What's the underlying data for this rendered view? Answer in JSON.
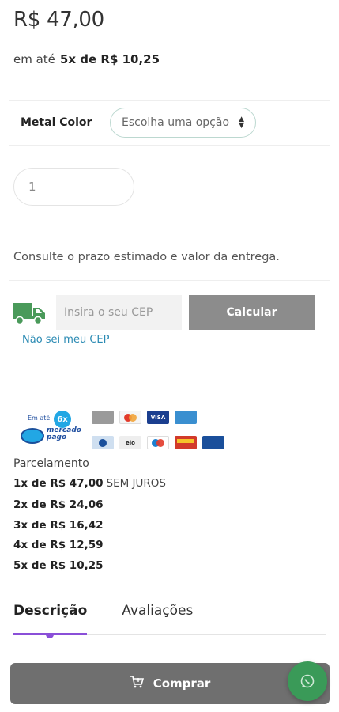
{
  "product": {
    "price": "R$ 47,00",
    "installment_prefix": "em até",
    "installment_value": "5x de R$ 10,25"
  },
  "variant": {
    "label": "Metal Color",
    "select_placeholder": "Escolha uma opção"
  },
  "quantity": {
    "value": "1"
  },
  "shipping": {
    "info": "Consulte o prazo estimado e valor da entrega.",
    "cep_placeholder": "Insira o seu CEP",
    "calculate_label": "Calcular",
    "no_cep_link": "Não sei meu CEP"
  },
  "payment": {
    "mp_upto": "Em até",
    "mp_badge": "6x",
    "mp_brand_line1": "mercado",
    "mp_brand_line2": "pago",
    "cards_row1": [
      {
        "name": "boleto",
        "color": "#9a9a9a"
      },
      {
        "name": "mastercard",
        "color": "#e8a13a"
      },
      {
        "name": "visa",
        "color": "#1a3e8f"
      },
      {
        "name": "amex",
        "color": "#3a8fd0"
      }
    ],
    "cards_row2": [
      {
        "name": "diners",
        "color": "#cfdff0"
      },
      {
        "name": "elo",
        "color": "#eeeeee"
      },
      {
        "name": "maestro",
        "color": "#e15b5b"
      },
      {
        "name": "hipercard",
        "color": "#d23a2a"
      },
      {
        "name": "visa-electron",
        "color": "#1a4f9b"
      }
    ]
  },
  "installments": {
    "title": "Parcelamento",
    "lines": [
      {
        "label": "1x de R$ 47,00",
        "note": "SEM JUROS"
      },
      {
        "label": "2x de R$ 24,06",
        "note": ""
      },
      {
        "label": "3x de R$ 16,42",
        "note": ""
      },
      {
        "label": "4x de R$ 12,59",
        "note": ""
      },
      {
        "label": "5x de R$ 10,25",
        "note": ""
      }
    ]
  },
  "tabs": {
    "description": "Descrição",
    "reviews": "Avaliações"
  },
  "buy": {
    "label": "Comprar"
  },
  "colors": {
    "accent_purple": "#8a4fd8",
    "link_blue": "#2a8ab3",
    "truck_green": "#4a9a5a",
    "whatsapp_green": "#3a9a58"
  }
}
